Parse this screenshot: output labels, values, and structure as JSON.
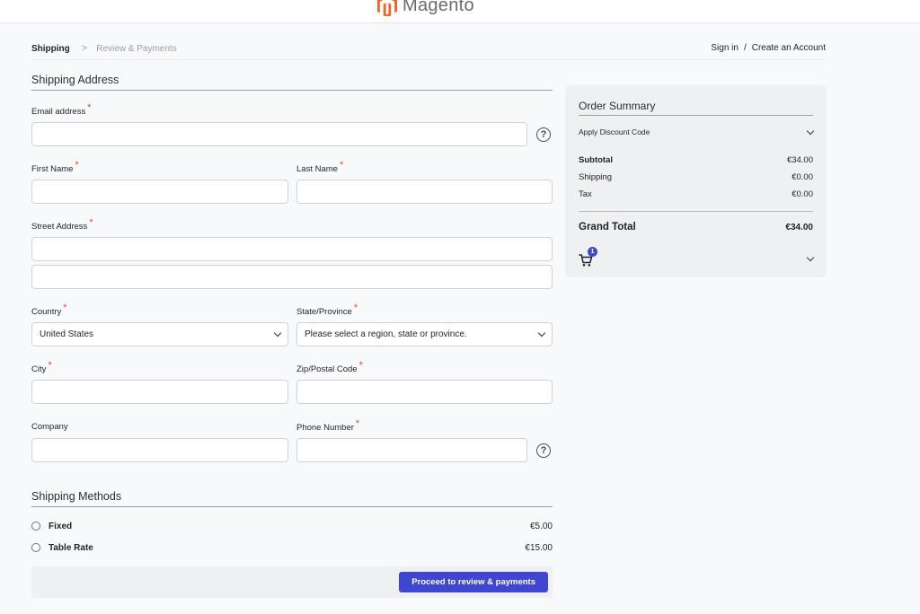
{
  "header": {
    "logo_text": "Magento"
  },
  "breadcrumb": {
    "step1": "Shipping",
    "separator": ">",
    "step2": "Review & Payments"
  },
  "account": {
    "sign_in": "Sign in",
    "separator": "/",
    "create": "Create an Account"
  },
  "shipping_address": {
    "title": "Shipping Address",
    "required_marker": "*",
    "email_label": "Email address",
    "first_name_label": "First Name",
    "last_name_label": "Last Name",
    "street_label": "Street Address",
    "country_label": "Country",
    "country_value": "United States",
    "state_label": "State/Province",
    "state_value": "Please select a region, state or province.",
    "city_label": "City",
    "zip_label": "Zip/Postal Code",
    "company_label": "Company",
    "phone_label": "Phone Number",
    "help_glyph": "?"
  },
  "shipping_methods": {
    "title": "Shipping Methods",
    "items": [
      {
        "name": "Fixed",
        "price": "€5.00"
      },
      {
        "name": "Table Rate",
        "price": "€15.00"
      }
    ]
  },
  "actions": {
    "proceed_label": "Proceed to review & payments"
  },
  "order_summary": {
    "title": "Order Summary",
    "discount_label": "Apply Discount Code",
    "subtotal_label": "Subtotal",
    "subtotal_value": "€34.00",
    "shipping_label": "Shipping",
    "shipping_value": "€0.00",
    "tax_label": "Tax",
    "tax_value": "€0.00",
    "grand_total_label": "Grand Total",
    "grand_total_value": "€34.00",
    "cart_count": "1"
  },
  "colors": {
    "accent": "#3f46cf",
    "required": "#e34a3a",
    "logo": "#f26322"
  },
  "icons": [
    "magento-logo-icon",
    "help-icon",
    "chevron-down-icon",
    "cart-icon",
    "radio-icon"
  ]
}
